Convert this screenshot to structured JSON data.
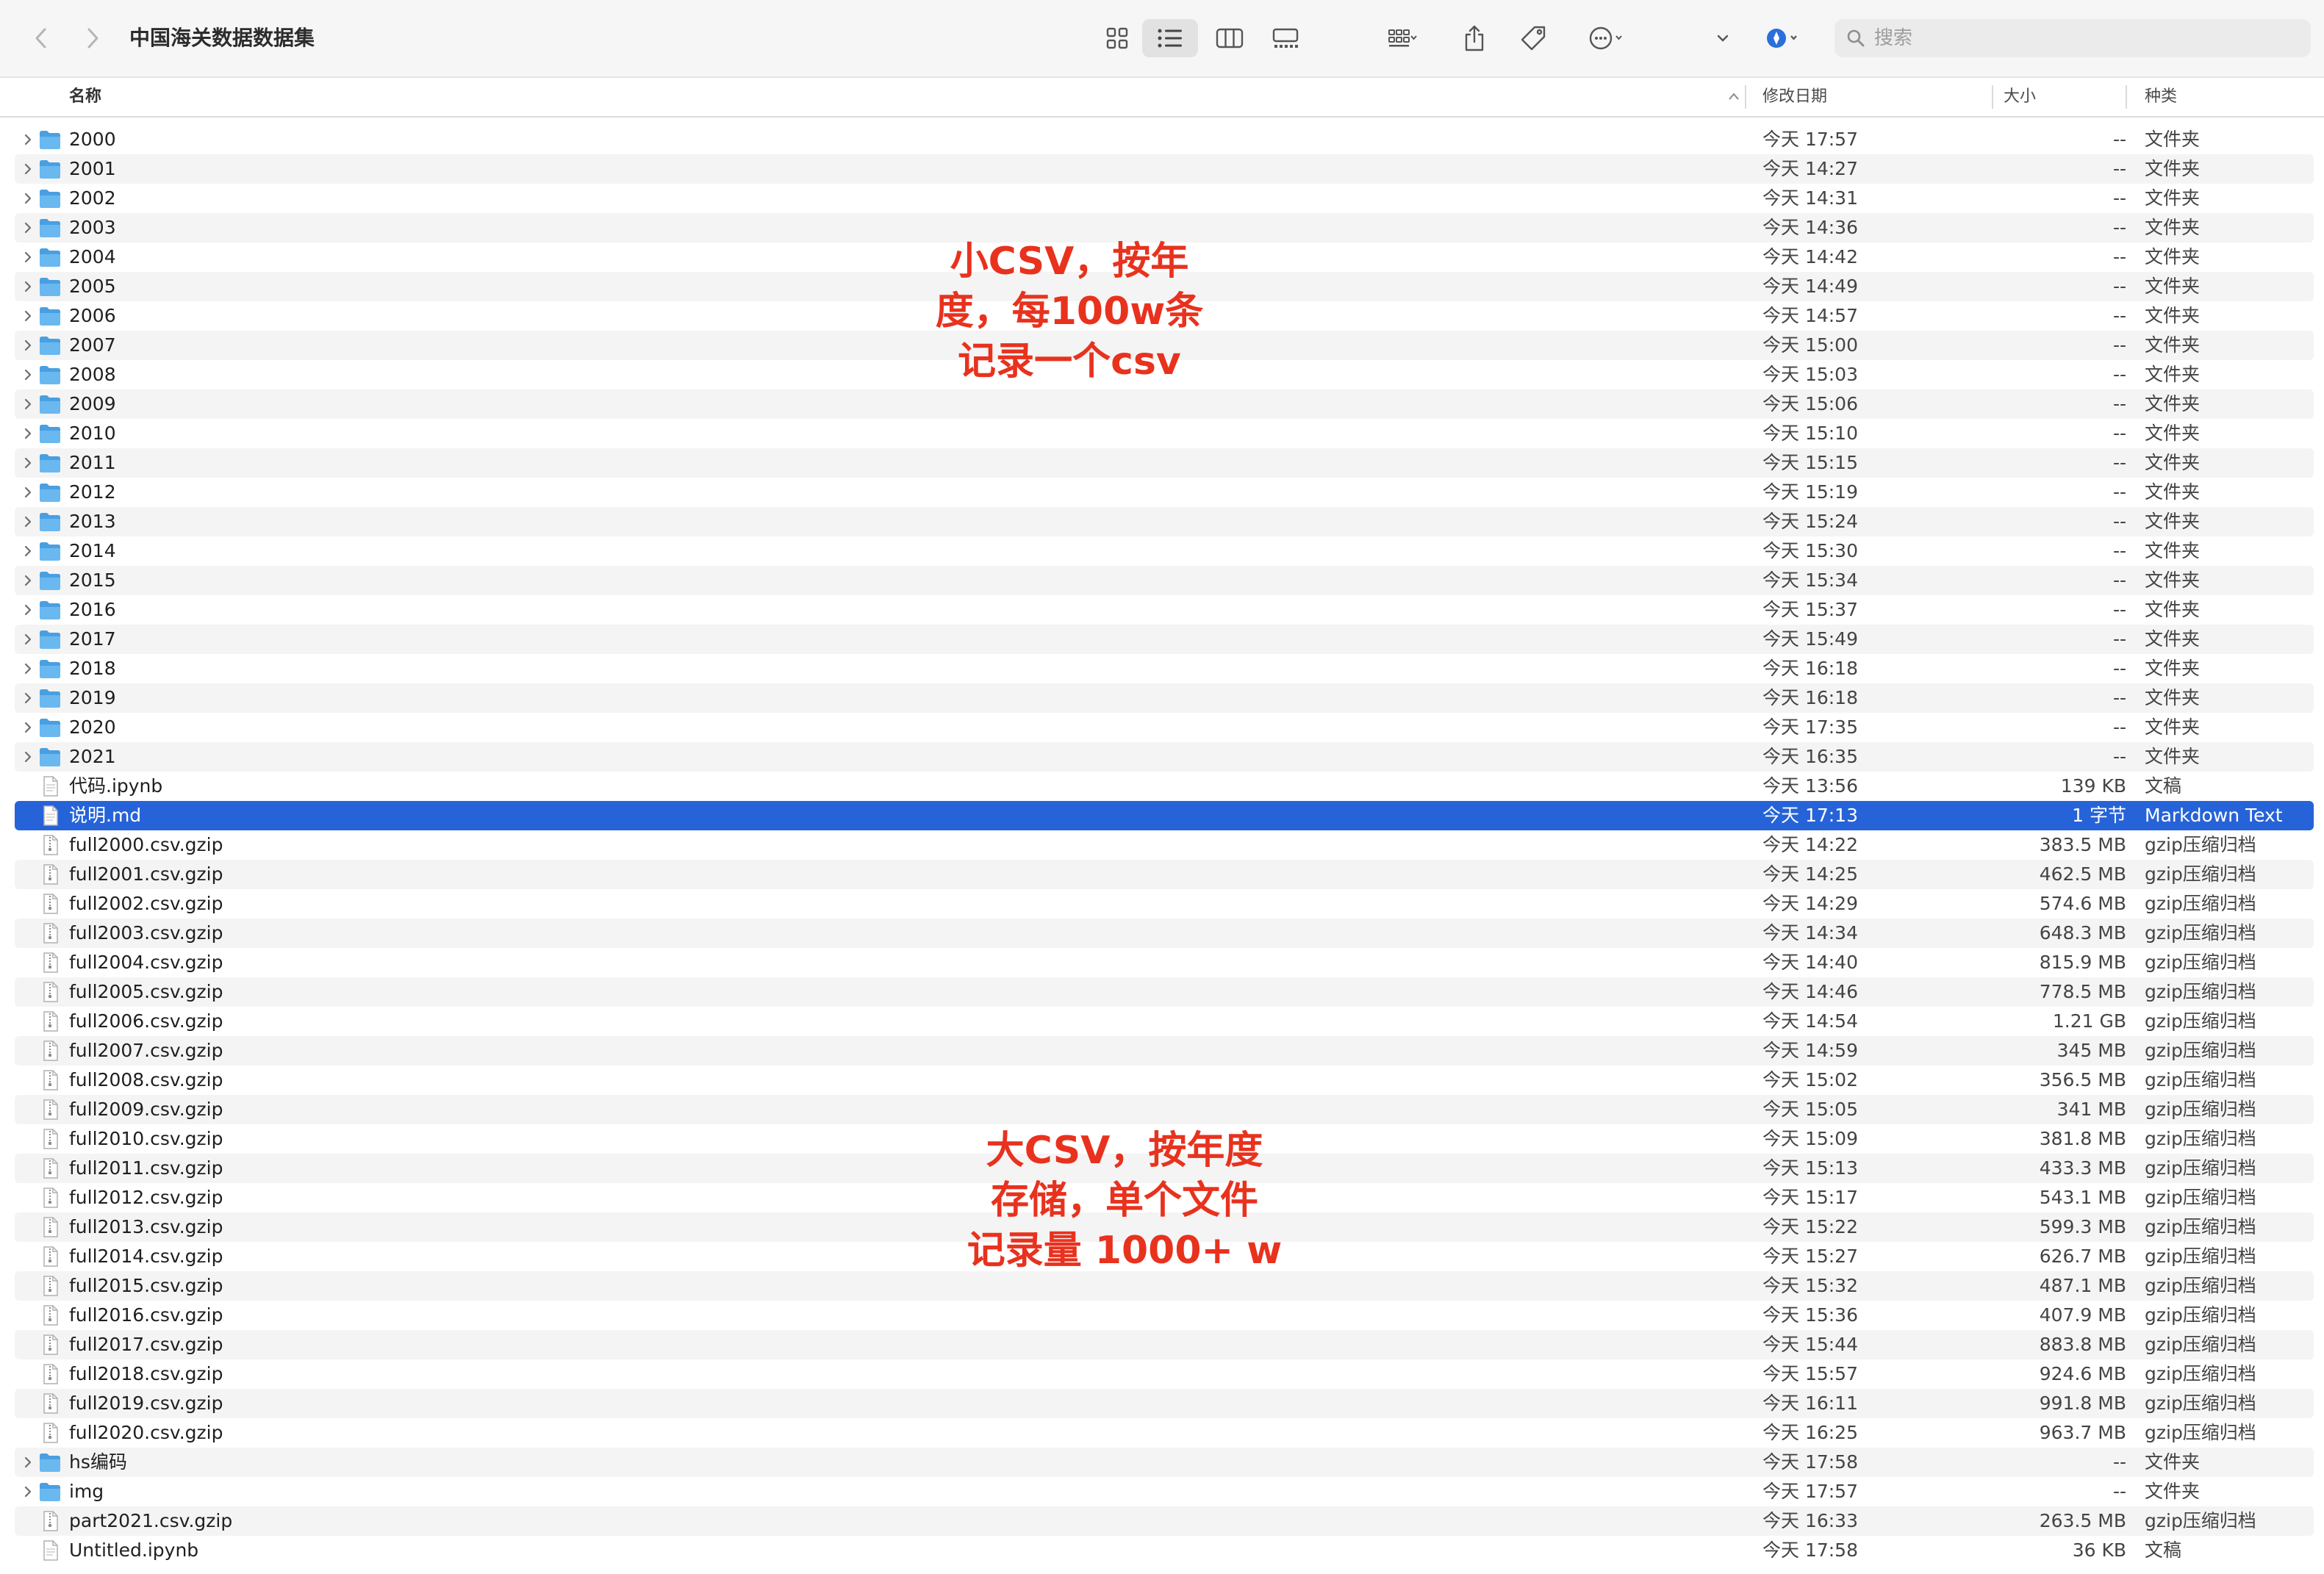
{
  "window": {
    "title": "中国海关数据数据集",
    "search_placeholder": "搜索"
  },
  "toolbar": {
    "back_icon": "chevron-left-icon",
    "forward_icon": "chevron-right-icon",
    "views": [
      "icon-view",
      "list-view",
      "column-view",
      "gallery-view"
    ],
    "selected_view": "list-view"
  },
  "columns": {
    "name": "名称",
    "date": "修改日期",
    "size": "大小",
    "kind": "种类"
  },
  "files": [
    {
      "name": "2000",
      "date": "今天 17:57",
      "size": "--",
      "kind": "文件夹",
      "type": "folder"
    },
    {
      "name": "2001",
      "date": "今天 14:27",
      "size": "--",
      "kind": "文件夹",
      "type": "folder"
    },
    {
      "name": "2002",
      "date": "今天 14:31",
      "size": "--",
      "kind": "文件夹",
      "type": "folder"
    },
    {
      "name": "2003",
      "date": "今天 14:36",
      "size": "--",
      "kind": "文件夹",
      "type": "folder"
    },
    {
      "name": "2004",
      "date": "今天 14:42",
      "size": "--",
      "kind": "文件夹",
      "type": "folder"
    },
    {
      "name": "2005",
      "date": "今天 14:49",
      "size": "--",
      "kind": "文件夹",
      "type": "folder"
    },
    {
      "name": "2006",
      "date": "今天 14:57",
      "size": "--",
      "kind": "文件夹",
      "type": "folder"
    },
    {
      "name": "2007",
      "date": "今天 15:00",
      "size": "--",
      "kind": "文件夹",
      "type": "folder"
    },
    {
      "name": "2008",
      "date": "今天 15:03",
      "size": "--",
      "kind": "文件夹",
      "type": "folder"
    },
    {
      "name": "2009",
      "date": "今天 15:06",
      "size": "--",
      "kind": "文件夹",
      "type": "folder"
    },
    {
      "name": "2010",
      "date": "今天 15:10",
      "size": "--",
      "kind": "文件夹",
      "type": "folder"
    },
    {
      "name": "2011",
      "date": "今天 15:15",
      "size": "--",
      "kind": "文件夹",
      "type": "folder"
    },
    {
      "name": "2012",
      "date": "今天 15:19",
      "size": "--",
      "kind": "文件夹",
      "type": "folder"
    },
    {
      "name": "2013",
      "date": "今天 15:24",
      "size": "--",
      "kind": "文件夹",
      "type": "folder"
    },
    {
      "name": "2014",
      "date": "今天 15:30",
      "size": "--",
      "kind": "文件夹",
      "type": "folder"
    },
    {
      "name": "2015",
      "date": "今天 15:34",
      "size": "--",
      "kind": "文件夹",
      "type": "folder"
    },
    {
      "name": "2016",
      "date": "今天 15:37",
      "size": "--",
      "kind": "文件夹",
      "type": "folder"
    },
    {
      "name": "2017",
      "date": "今天 15:49",
      "size": "--",
      "kind": "文件夹",
      "type": "folder"
    },
    {
      "name": "2018",
      "date": "今天 16:18",
      "size": "--",
      "kind": "文件夹",
      "type": "folder"
    },
    {
      "name": "2019",
      "date": "今天 16:18",
      "size": "--",
      "kind": "文件夹",
      "type": "folder"
    },
    {
      "name": "2020",
      "date": "今天 17:35",
      "size": "--",
      "kind": "文件夹",
      "type": "folder"
    },
    {
      "name": "2021",
      "date": "今天 16:35",
      "size": "--",
      "kind": "文件夹",
      "type": "folder"
    },
    {
      "name": "代码.ipynb",
      "date": "今天 13:56",
      "size": "139 KB",
      "kind": "文稿",
      "type": "doc"
    },
    {
      "name": "说明.md",
      "date": "今天 17:13",
      "size": "1 字节",
      "kind": "Markdown Text",
      "type": "doc",
      "selected": true
    },
    {
      "name": "full2000.csv.gzip",
      "date": "今天 14:22",
      "size": "383.5 MB",
      "kind": "gzip压缩归档",
      "type": "archive"
    },
    {
      "name": "full2001.csv.gzip",
      "date": "今天 14:25",
      "size": "462.5 MB",
      "kind": "gzip压缩归档",
      "type": "archive"
    },
    {
      "name": "full2002.csv.gzip",
      "date": "今天 14:29",
      "size": "574.6 MB",
      "kind": "gzip压缩归档",
      "type": "archive"
    },
    {
      "name": "full2003.csv.gzip",
      "date": "今天 14:34",
      "size": "648.3 MB",
      "kind": "gzip压缩归档",
      "type": "archive"
    },
    {
      "name": "full2004.csv.gzip",
      "date": "今天 14:40",
      "size": "815.9 MB",
      "kind": "gzip压缩归档",
      "type": "archive"
    },
    {
      "name": "full2005.csv.gzip",
      "date": "今天 14:46",
      "size": "778.5 MB",
      "kind": "gzip压缩归档",
      "type": "archive"
    },
    {
      "name": "full2006.csv.gzip",
      "date": "今天 14:54",
      "size": "1.21 GB",
      "kind": "gzip压缩归档",
      "type": "archive"
    },
    {
      "name": "full2007.csv.gzip",
      "date": "今天 14:59",
      "size": "345 MB",
      "kind": "gzip压缩归档",
      "type": "archive"
    },
    {
      "name": "full2008.csv.gzip",
      "date": "今天 15:02",
      "size": "356.5 MB",
      "kind": "gzip压缩归档",
      "type": "archive"
    },
    {
      "name": "full2009.csv.gzip",
      "date": "今天 15:05",
      "size": "341 MB",
      "kind": "gzip压缩归档",
      "type": "archive"
    },
    {
      "name": "full2010.csv.gzip",
      "date": "今天 15:09",
      "size": "381.8 MB",
      "kind": "gzip压缩归档",
      "type": "archive"
    },
    {
      "name": "full2011.csv.gzip",
      "date": "今天 15:13",
      "size": "433.3 MB",
      "kind": "gzip压缩归档",
      "type": "archive"
    },
    {
      "name": "full2012.csv.gzip",
      "date": "今天 15:17",
      "size": "543.1 MB",
      "kind": "gzip压缩归档",
      "type": "archive"
    },
    {
      "name": "full2013.csv.gzip",
      "date": "今天 15:22",
      "size": "599.3 MB",
      "kind": "gzip压缩归档",
      "type": "archive"
    },
    {
      "name": "full2014.csv.gzip",
      "date": "今天 15:27",
      "size": "626.7 MB",
      "kind": "gzip压缩归档",
      "type": "archive"
    },
    {
      "name": "full2015.csv.gzip",
      "date": "今天 15:32",
      "size": "487.1 MB",
      "kind": "gzip压缩归档",
      "type": "archive"
    },
    {
      "name": "full2016.csv.gzip",
      "date": "今天 15:36",
      "size": "407.9 MB",
      "kind": "gzip压缩归档",
      "type": "archive"
    },
    {
      "name": "full2017.csv.gzip",
      "date": "今天 15:44",
      "size": "883.8 MB",
      "kind": "gzip压缩归档",
      "type": "archive"
    },
    {
      "name": "full2018.csv.gzip",
      "date": "今天 15:57",
      "size": "924.6 MB",
      "kind": "gzip压缩归档",
      "type": "archive"
    },
    {
      "name": "full2019.csv.gzip",
      "date": "今天 16:11",
      "size": "991.8 MB",
      "kind": "gzip压缩归档",
      "type": "archive"
    },
    {
      "name": "full2020.csv.gzip",
      "date": "今天 16:25",
      "size": "963.7 MB",
      "kind": "gzip压缩归档",
      "type": "archive"
    },
    {
      "name": "hs编码",
      "date": "今天 17:58",
      "size": "--",
      "kind": "文件夹",
      "type": "folder"
    },
    {
      "name": "img",
      "date": "今天 17:57",
      "size": "--",
      "kind": "文件夹",
      "type": "folder"
    },
    {
      "name": "part2021.csv.gzip",
      "date": "今天 16:33",
      "size": "263.5 MB",
      "kind": "gzip压缩归档",
      "type": "archive"
    },
    {
      "name": "Untitled.ipynb",
      "date": "今天 17:58",
      "size": "36 KB",
      "kind": "文稿",
      "type": "doc"
    }
  ],
  "annotations": {
    "top": [
      "小CSV，按年",
      "度，每100w条",
      "记录一个csv"
    ],
    "bottom": [
      "大CSV，按年度",
      "存储，单个文件",
      "记录量 1000+ w"
    ],
    "color": "#e8321e"
  },
  "colors": {
    "selection": "#2663d8",
    "folder": "#5aa9e6",
    "accent_blue": "#2a6fdb"
  }
}
